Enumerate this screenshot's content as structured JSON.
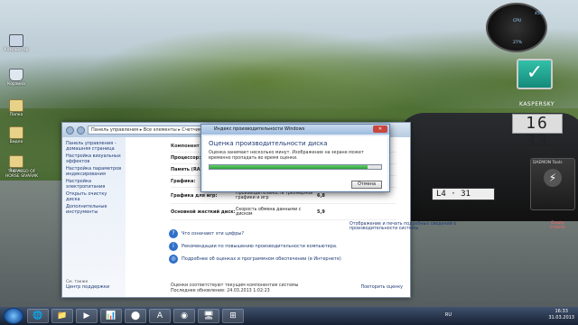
{
  "desktop": {
    "icons": [
      {
        "label": "Компьютер",
        "kind": "pc"
      },
      {
        "label": "Корзина",
        "kind": "bin"
      },
      {
        "label": "Папка",
        "kind": "folder"
      },
      {
        "label": "Видео",
        "kind": "folder"
      },
      {
        "label": "Видео",
        "kind": "folder"
      },
      {
        "label": "THE ALGO OF HORSE\nSIVARAK",
        "kind": "folder"
      }
    ]
  },
  "gadgets": {
    "cpu_label": "CPU",
    "cpu_value": "27%",
    "ram_value": "45%",
    "kaspersky": "KASPERSKY",
    "clock": "16 33",
    "daemon_title": "DAEMON Tools",
    "empty_label": "Empty",
    "empty_sub": "0 items"
  },
  "window": {
    "breadcrumb": "Панель управления ▸ Все элементы ▸ Счетчики и средства производительности",
    "left_links": [
      "Панель управления - домашняя страница",
      "Настройка визуальных эффектов",
      "Настройка параметров индексирования",
      "Настройка электропитания",
      "Открыть очистку диска",
      "Дополнительные инструменты"
    ],
    "see_also": "См. также",
    "action_center": "Центр поддержки",
    "table": {
      "header": "Компонент",
      "rows": [
        {
          "comp": "Процессор:",
          "desc": "",
          "val": ""
        },
        {
          "comp": "Память (RAM):",
          "desc": "",
          "val": ""
        },
        {
          "comp": "Графика:",
          "desc": "",
          "val": ""
        },
        {
          "comp": "Графика для игр:",
          "desc": "Производительность трехмерной графики и игр",
          "val": "6,8"
        },
        {
          "comp": "Основной жесткий диск:",
          "desc": "Скорость обмена данными с диском",
          "val": "5,9"
        }
      ]
    },
    "links": [
      {
        "text": "Что означают эти цифры?"
      },
      {
        "text": "Рекомендации по повышению производительности компьютера."
      },
      {
        "text": "Подробнее об оценках и программном обеспечении (в Интернете)"
      }
    ],
    "side_note": "Отображение и печать подробных сведений о производительности системы",
    "footer_line1": "Оценки соответствуют текущим компонентам системы",
    "footer_line2": "Последнее обновление: 24.03.2013 1:02:23",
    "rerun": "Повторить оценку"
  },
  "dialog": {
    "title": "Индекс производительности Windows",
    "heading": "Оценка производительности диска",
    "text": "Оценка занимает несколько минут. Изображение на экране может временно пропадать во время оценки.",
    "progress": 0.92,
    "cancel": "Отмена"
  },
  "taskbar": {
    "lang": "RU",
    "time": "16:33",
    "date": "31.03.2013",
    "apps": [
      "🌐",
      "📁",
      "▶",
      "📊",
      "⬤",
      "A",
      "◉",
      "🖥",
      "⊞"
    ]
  }
}
